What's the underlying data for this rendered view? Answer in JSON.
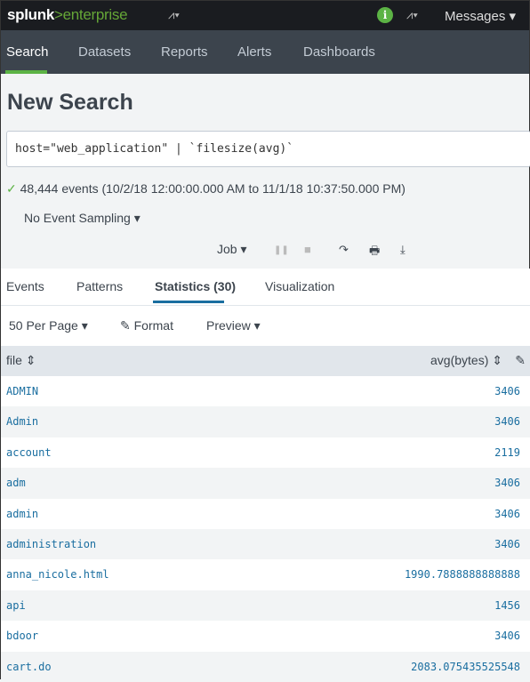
{
  "header": {
    "logo": "splunk",
    "logo_suffix": ">enterprise",
    "activity_icon": "activity-icon",
    "info_icon": "i",
    "messages": "Messages ▾"
  },
  "nav": [
    "Search",
    "Datasets",
    "Reports",
    "Alerts",
    "Dashboards"
  ],
  "page_title": "New Search",
  "search_query": "host=\"web_application\" | `filesize(avg)`",
  "summary": {
    "check": "✓",
    "text": "48,444 events (10/2/18 12:00:00.000 AM to 11/1/18 10:37:50.000 PM)"
  },
  "sampling": "No Event Sampling ▾",
  "job": {
    "label": "Job ▾",
    "pause": "❚❚",
    "stop": "■",
    "share": "↷",
    "print": "🖶",
    "export": "⤓"
  },
  "tabs": [
    "Events",
    "Patterns",
    "Statistics (30)",
    "Visualization"
  ],
  "toolbar": {
    "per_page": "50 Per Page ▾",
    "format": "✎ Format",
    "preview": "Preview ▾"
  },
  "table": {
    "columns": [
      "file ⇕",
      "avg(bytes) ⇕"
    ],
    "edit_icon": "✎",
    "rows": [
      {
        "file": "ADMIN",
        "avg": "3406"
      },
      {
        "file": "Admin",
        "avg": "3406"
      },
      {
        "file": "account",
        "avg": "2119"
      },
      {
        "file": "adm",
        "avg": "3406"
      },
      {
        "file": "admin",
        "avg": "3406"
      },
      {
        "file": "administration",
        "avg": "3406"
      },
      {
        "file": "anna_nicole.html",
        "avg": "1990.7888888888888"
      },
      {
        "file": "api",
        "avg": "1456"
      },
      {
        "file": "bdoor",
        "avg": "3406"
      },
      {
        "file": "cart.do",
        "avg": "2083.075435525548"
      }
    ]
  }
}
